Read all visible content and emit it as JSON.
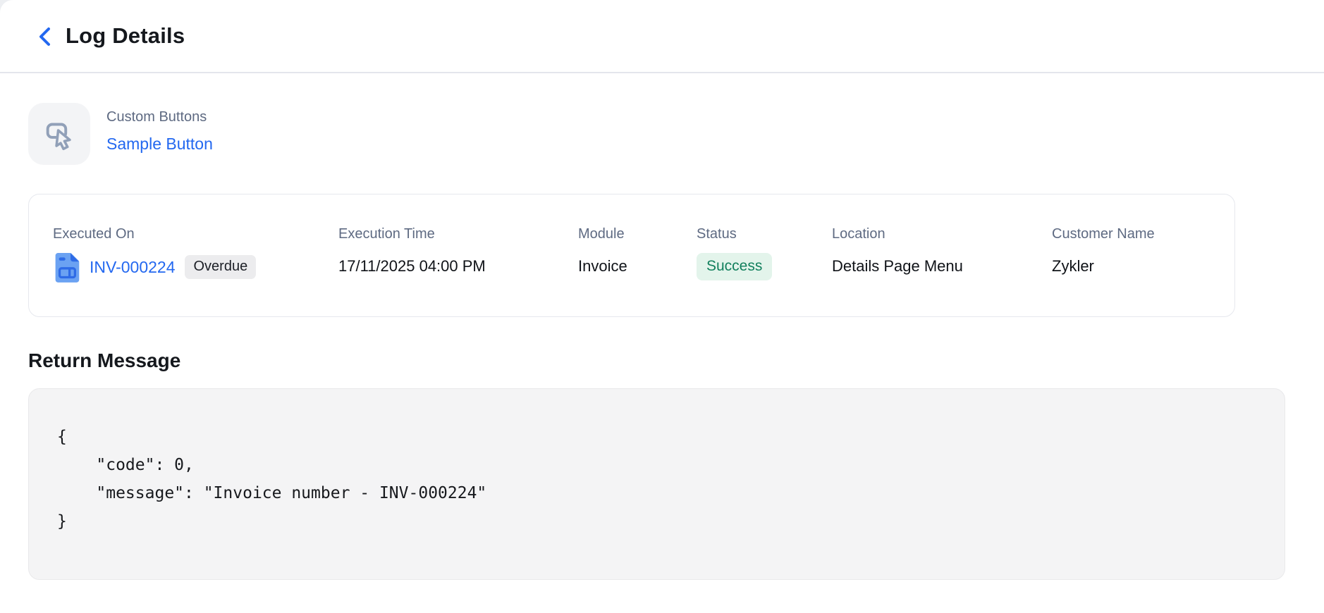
{
  "header": {
    "title": "Log Details",
    "back_icon": "chevron-left"
  },
  "custom_buttons": {
    "section_label": "Custom Buttons",
    "button_name": "Sample Button",
    "icon": "custom-button-pointer"
  },
  "log_card": {
    "fields": [
      {
        "label": "Executed On",
        "value": "INV-000224",
        "badge": "Overdue",
        "icon": "invoice-document"
      },
      {
        "label": "Execution Time",
        "value": "17/11/2025 04:00 PM"
      },
      {
        "label": "Module",
        "value": "Invoice"
      },
      {
        "label": "Status",
        "value": "Success"
      },
      {
        "label": "Location",
        "value": "Details Page Menu"
      },
      {
        "label": "Customer Name",
        "value": "Zykler"
      }
    ]
  },
  "return_message": {
    "heading": "Return Message",
    "code": "{\n    \"code\": 0,\n    \"message\": \"Invoice number - INV-000224\"\n}"
  },
  "colors": {
    "link_blue": "#2368f0",
    "success_text": "#12805d",
    "success_bg": "#e3f4eb",
    "overdue_bg": "#ececee",
    "label_gray": "#5e6a82",
    "card_border": "#e6e8ee",
    "code_bg": "#f4f4f5"
  }
}
